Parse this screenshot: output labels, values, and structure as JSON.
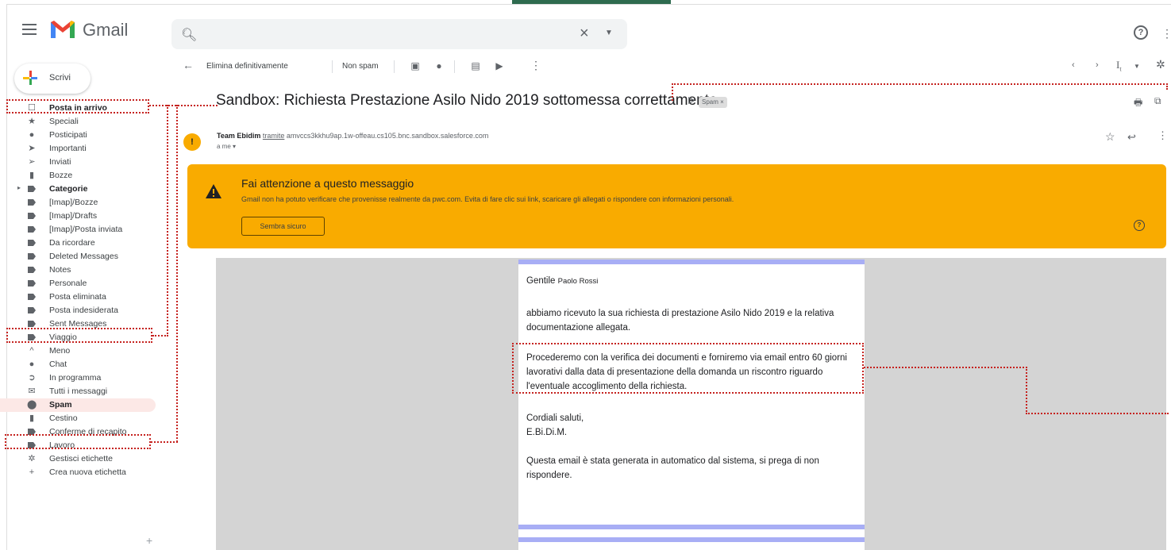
{
  "app": {
    "brand": "Gmail"
  },
  "search": {
    "value": "",
    "placeholder": ""
  },
  "compose": {
    "label": "Scrivi"
  },
  "sidebar": {
    "items": [
      {
        "label": "Posta in arrivo",
        "icon": "inbox-icon"
      },
      {
        "label": "Speciali",
        "icon": "star-icon"
      },
      {
        "label": "Posticipati",
        "icon": "clock-icon"
      },
      {
        "label": "Importanti",
        "icon": "important-icon"
      },
      {
        "label": "Inviati",
        "icon": "send-icon"
      },
      {
        "label": "Bozze",
        "icon": "draft-icon"
      },
      {
        "label": "Categorie",
        "icon": "label-icon"
      },
      {
        "label": "[Imap]/Bozze",
        "icon": "label-icon"
      },
      {
        "label": "[Imap]/Drafts",
        "icon": "label-icon"
      },
      {
        "label": "[Imap]/Posta inviata",
        "icon": "label-icon"
      },
      {
        "label": "Da ricordare",
        "icon": "label-icon"
      },
      {
        "label": "Deleted Messages",
        "icon": "label-icon"
      },
      {
        "label": "Notes",
        "icon": "label-icon"
      },
      {
        "label": "Personale",
        "icon": "label-icon"
      },
      {
        "label": "Posta eliminata",
        "icon": "label-icon"
      },
      {
        "label": "Posta indesiderata",
        "icon": "label-icon"
      },
      {
        "label": "Sent Messages",
        "icon": "label-icon"
      },
      {
        "label": "Viaggio",
        "icon": "label-icon"
      },
      {
        "label": "Meno",
        "icon": "chevron-up-icon"
      },
      {
        "label": "Chat",
        "icon": "chat-icon"
      },
      {
        "label": "In programma",
        "icon": "scheduled-icon"
      },
      {
        "label": "Tutti i messaggi",
        "icon": "all-mail-icon"
      },
      {
        "label": "Spam",
        "icon": "spam-icon"
      },
      {
        "label": "Cestino",
        "icon": "trash-icon"
      },
      {
        "label": "Conferme di recapito",
        "icon": "label-icon"
      },
      {
        "label": "Lavoro",
        "icon": "label-icon"
      },
      {
        "label": "Gestisci etichette",
        "icon": "gear-icon"
      },
      {
        "label": "Crea nuova etichetta",
        "icon": "plus-icon"
      }
    ]
  },
  "toolbar": {
    "delete_forever": "Elimina definitivamente",
    "not_spam": "Non spam",
    "input_tools": "I",
    "input_tools_sub": "t"
  },
  "message": {
    "subject": "Sandbox: Richiesta Prestazione Asilo Nido 2019 sottomessa correttamente",
    "spam_chip": "Spam",
    "sender_name": "Team Ebidim",
    "via": "tramite",
    "sender_address": "amvccs3kkhu9ap.1w-offeau.cs105.bnc.sandbox.salesforce.com",
    "to": "a me",
    "avatar_letter": "!"
  },
  "warning": {
    "title": "Fai attenzione a questo messaggio",
    "text": "Gmail non ha potuto verificare che provenisse realmente da pwc.com. Evita di fare clic sui link, scaricare gli allegati o rispondere con informazioni personali.",
    "button": "Sembra sicuro"
  },
  "body": {
    "greeting": "Gentile",
    "recipient_name": "Paolo Rossi",
    "p1": "abbiamo ricevuto la sua richiesta di prestazione Asilo Nido 2019 e la relativa documentazione allegata.",
    "p2": "Procederemo con la verifica dei documenti e forniremo via email entro 60 giorni lavorativi dalla data di presentazione della domanda un riscontro riguardo l'eventuale accoglimento della richiesta.",
    "closing": "Cordiali saluti,",
    "signature": "E.Bi.Di.M.",
    "footer": "Questa email è stata generata in automatico dal sistema, si prega di non rispondere."
  },
  "colors": {
    "warning_bg": "#f9ab00",
    "annotation": "#c5221f",
    "card_bar": "#a8aef5"
  }
}
